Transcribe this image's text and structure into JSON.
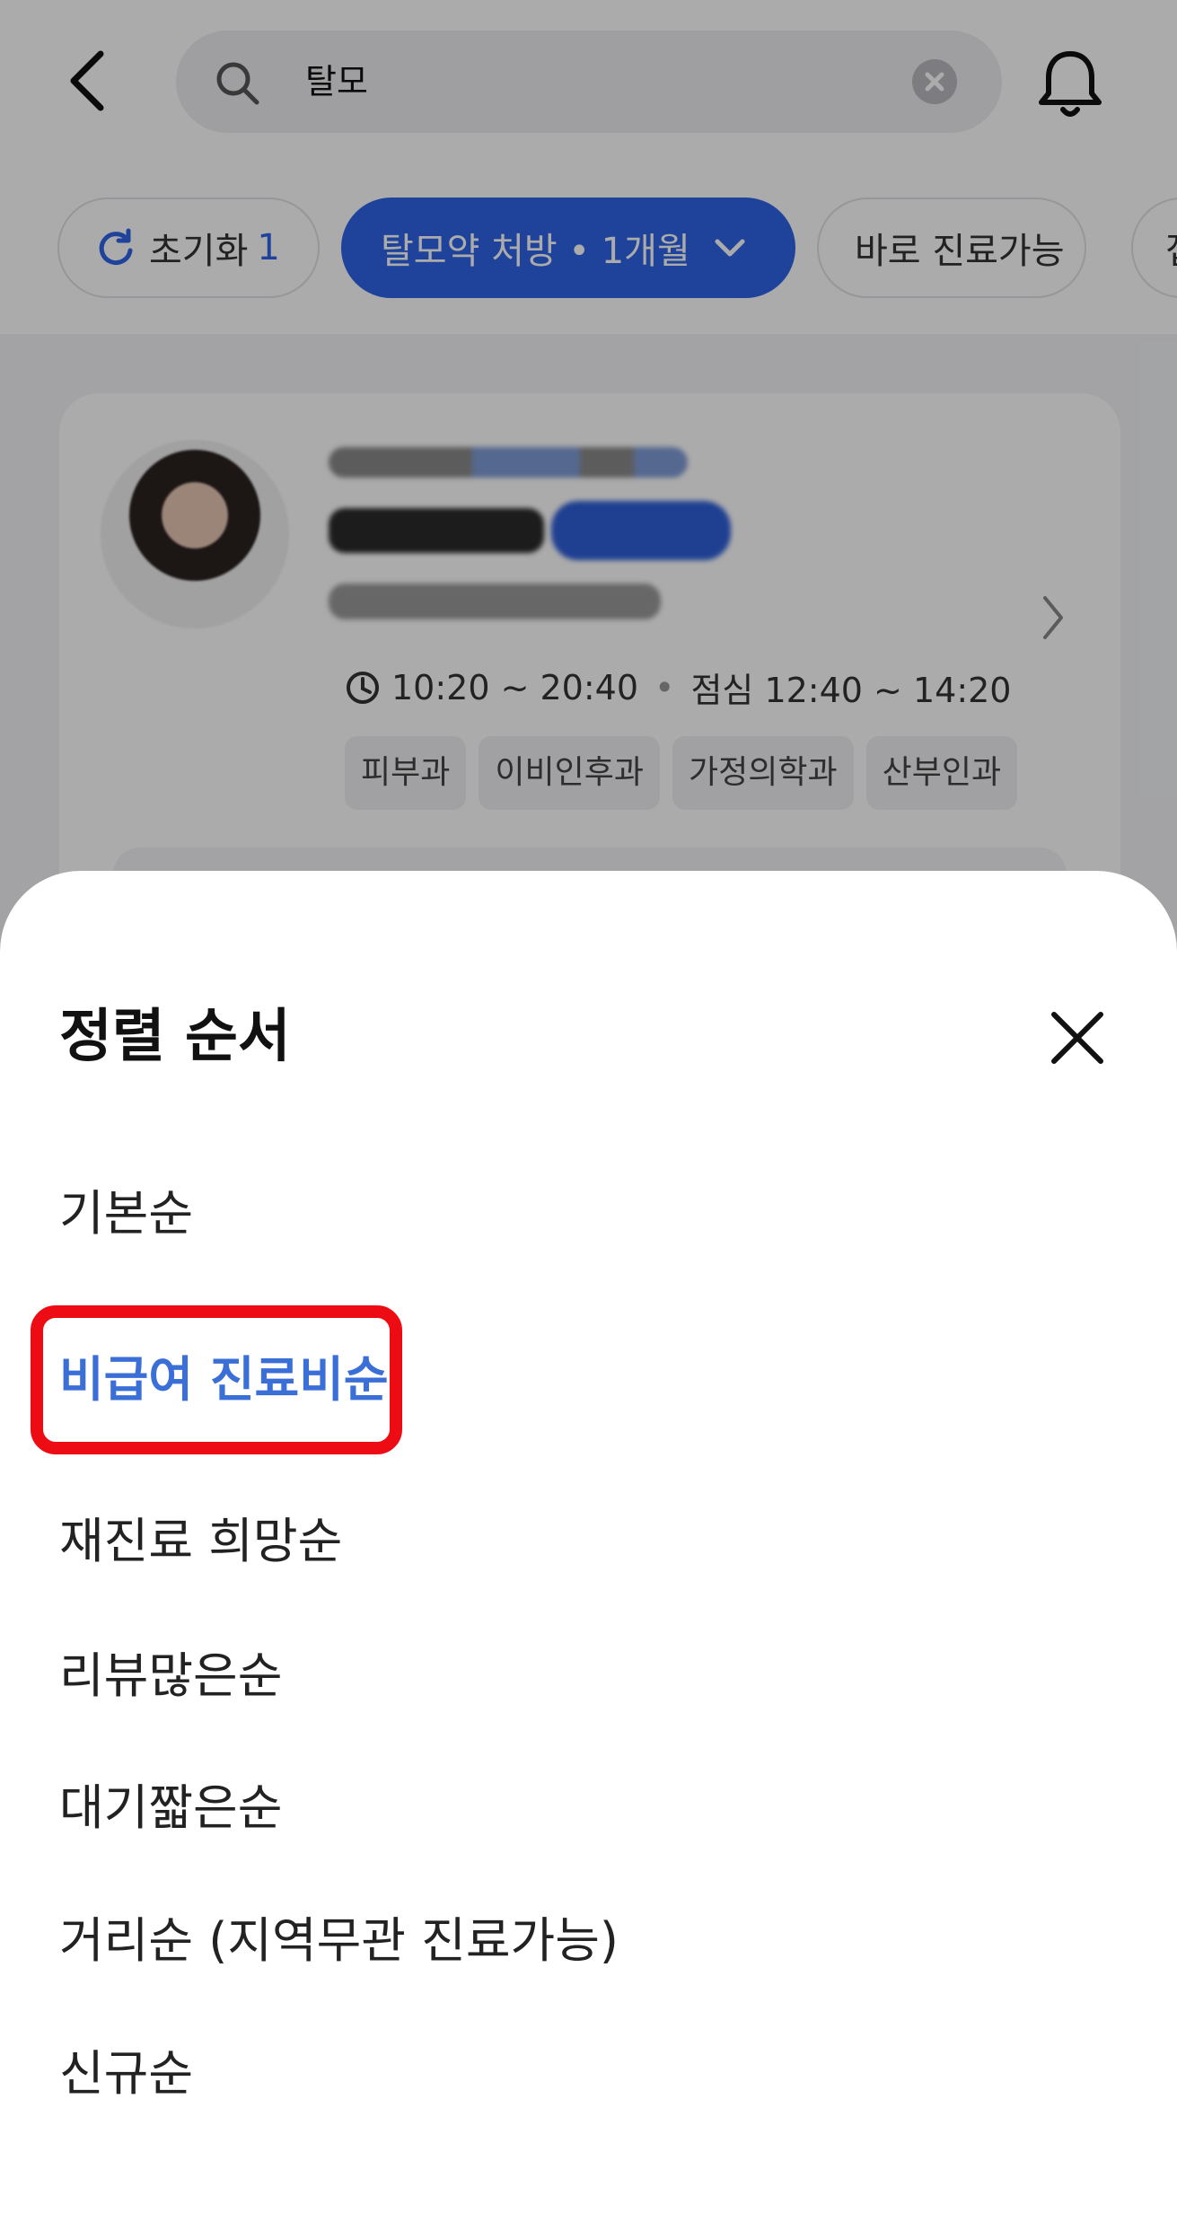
{
  "header": {
    "search_query": "탈모"
  },
  "filters": {
    "reset_label": "초기화",
    "reset_count": "1",
    "active_label": "탈모약 처방 • 1개월",
    "now_label": "바로 진료가능",
    "more_label": "접수"
  },
  "card": {
    "hours": "10:20 ~ 20:40",
    "lunch": "점심 12:40 ~ 14:20",
    "tags": [
      "피부과",
      "이비인후과",
      "가정의학과",
      "산부인과"
    ]
  },
  "sheet": {
    "title": "정렬 순서",
    "options": [
      "기본순",
      "비급여 진료비순",
      "재진료 희망순",
      "리뷰많은순",
      "대기짧은순",
      "거리순 (지역무관 진료가능)",
      "신규순"
    ],
    "selected_index": 1
  },
  "colors": {
    "accent": "#3b6fd8",
    "highlight_box": "#ee0c14"
  }
}
